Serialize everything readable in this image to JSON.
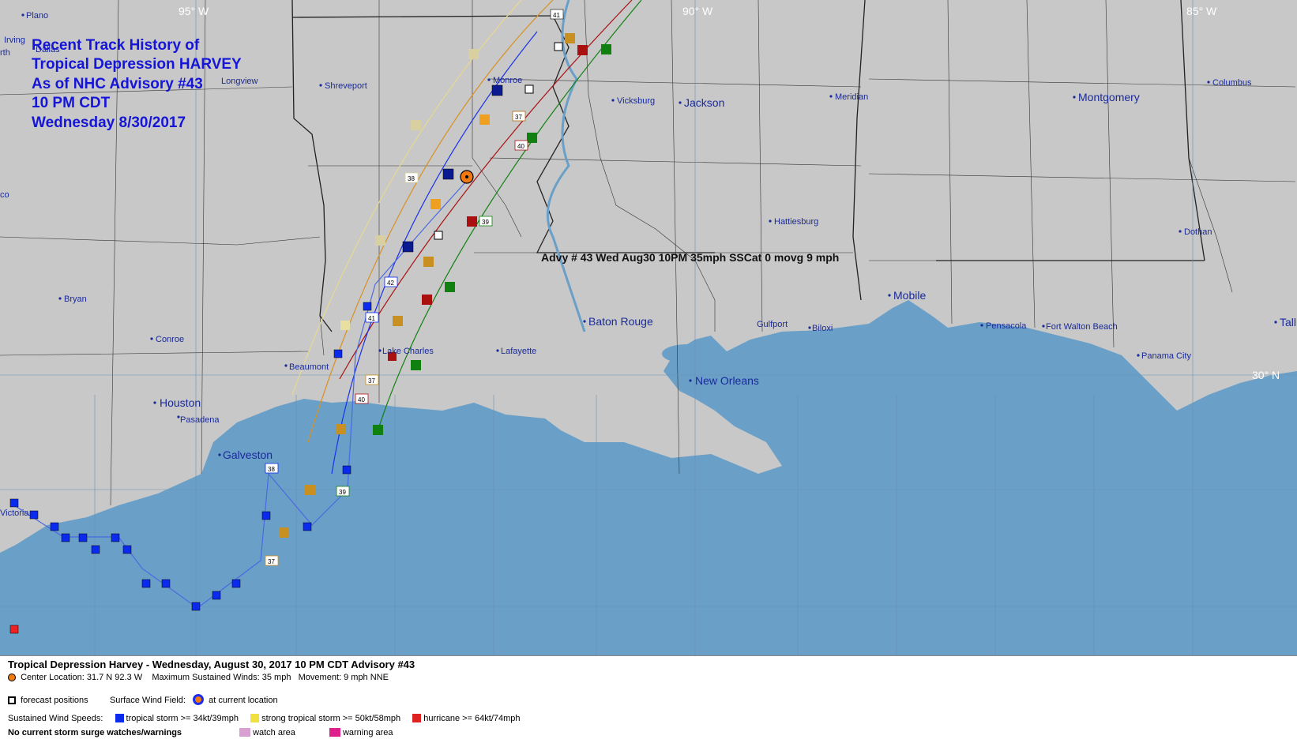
{
  "map": {
    "title_lines": [
      "Recent Track History of",
      "Tropical Depression HARVEY",
      "As of NHC Advisory #43",
      "10 PM CDT",
      "Wednesday 8/30/2017"
    ],
    "advisory_annotation": "Advy # 43 Wed Aug30 10PM  35mph SSCat 0 movg 9 mph",
    "longitude_labels": [
      "95° W",
      "90° W",
      "85° W"
    ],
    "latitude_labels": [
      "30° N"
    ],
    "cities": [
      {
        "name": "Plano"
      },
      {
        "name": "Irving"
      },
      {
        "name": "Dallas"
      },
      {
        "name": "Longview"
      },
      {
        "name": "Shreveport"
      },
      {
        "name": "Monroe"
      },
      {
        "name": "Vicksburg"
      },
      {
        "name": "Jackson"
      },
      {
        "name": "Meridian"
      },
      {
        "name": "Montgomery"
      },
      {
        "name": "Columbus"
      },
      {
        "name": "Hattiesburg"
      },
      {
        "name": "Dothan"
      },
      {
        "name": "Bryan"
      },
      {
        "name": "Conroe"
      },
      {
        "name": "Beaumont"
      },
      {
        "name": "Lake Charles"
      },
      {
        "name": "Lafayette"
      },
      {
        "name": "Baton Rouge"
      },
      {
        "name": "Gulfport"
      },
      {
        "name": "Biloxi"
      },
      {
        "name": "Mobile"
      },
      {
        "name": "Pensacola"
      },
      {
        "name": "Fort Walton Beach"
      },
      {
        "name": "Panama City"
      },
      {
        "name": "New Orleans"
      },
      {
        "name": "Houston"
      },
      {
        "name": "Pasadena"
      },
      {
        "name": "Galveston"
      },
      {
        "name": "Victoria"
      },
      {
        "name": "Tall"
      },
      {
        "name": "co"
      },
      {
        "name": "rth"
      }
    ],
    "advisory_labels": [
      "41",
      "37",
      "40",
      "38",
      "39",
      "42",
      "41",
      "37",
      "40",
      "38",
      "39",
      "37"
    ],
    "colors": {
      "water": "#6a9fc8",
      "land": "#c8c8c8",
      "tropical_storm": "#0a2aee",
      "strong_tropical_storm": "#f0e040",
      "hurricane": "#dd2222",
      "current_location": "#f07a10",
      "label_blue": "#1515d8"
    }
  },
  "legend": {
    "title": "Tropical Depression Harvey  -  Wednesday, August 30, 2017  10 PM CDT   Advisory #43",
    "center_location": "Center Location: 31.7 N  92.3 W",
    "max_winds": "Maximum Sustained Winds: 35 mph",
    "movement": "Movement: 9 mph NNE",
    "forecast_positions": "forecast positions",
    "surface_wind_field": "Surface Wind Field:",
    "at_current_location": "at current location",
    "sustained_wind_speeds": "Sustained Wind Speeds:",
    "tropical_storm": "tropical storm >= 34kt/39mph",
    "strong_tropical_storm": "strong tropical storm >= 50kt/58mph",
    "hurricane": "hurricane >= 64kt/74mph",
    "no_surge": "No current storm surge watches/warnings",
    "watch_area": "watch area",
    "warning_area": "warning area"
  }
}
